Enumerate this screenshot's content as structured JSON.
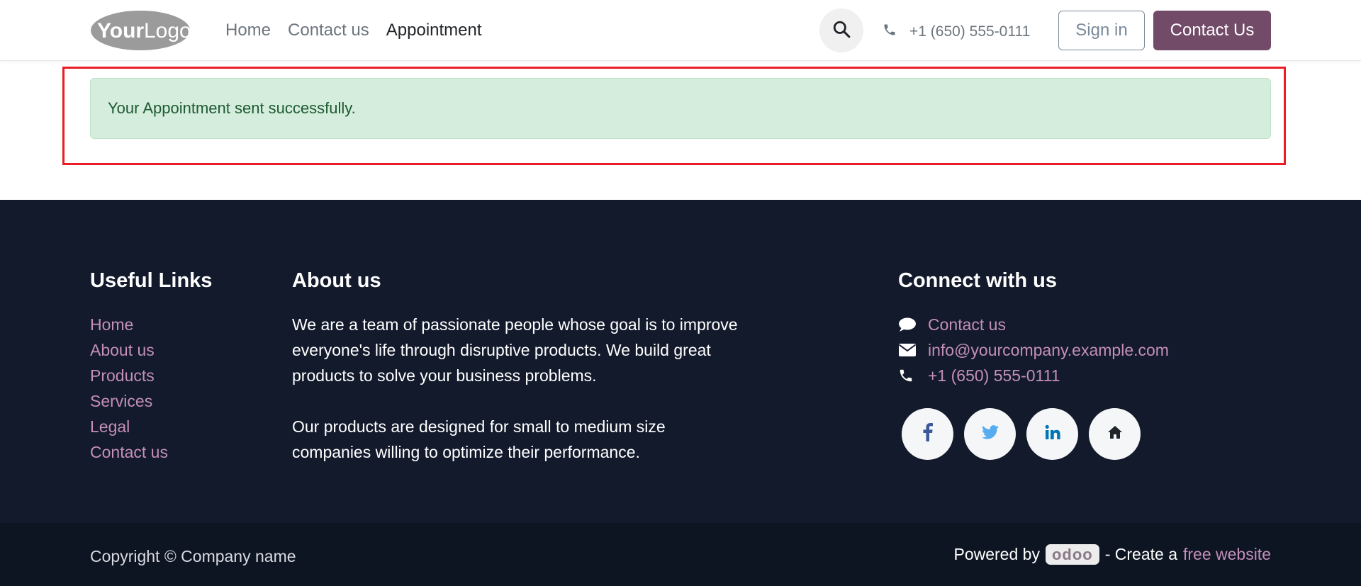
{
  "header": {
    "logo_text": "YourLogo",
    "nav": [
      "Home",
      "Contact us",
      "Appointment"
    ],
    "active_nav": "Appointment",
    "phone": "+1 (650) 555-0111",
    "signin_label": "Sign in",
    "contact_label": "Contact Us"
  },
  "alert": {
    "message": "Your Appointment sent successfully."
  },
  "footer": {
    "useful_links": {
      "title": "Useful Links",
      "items": [
        "Home",
        "About us",
        "Products",
        "Services",
        "Legal",
        "Contact us"
      ]
    },
    "about": {
      "title": "About us",
      "paragraph1": "We are a team of passionate people whose goal is to improve\neveryone's life through disruptive products. We build great\nproducts to solve your business problems.",
      "paragraph2": "Our products are designed for small to medium size\ncompanies willing to optimize their performance."
    },
    "connect": {
      "title": "Connect with us",
      "contact": "Contact us",
      "email": "info@yourcompany.example.com",
      "phone": "+1 (650) 555-0111",
      "social_icons": [
        "facebook-icon",
        "twitter-icon",
        "linkedin-icon",
        "home-icon"
      ]
    }
  },
  "bottom": {
    "copyright": "Copyright © Company name",
    "powered_by": "Powered by",
    "odoo": "odoo",
    "create": "- Create a",
    "free_website": "free website"
  },
  "colors": {
    "brand": "#714b67",
    "link": "#c48fb8",
    "footer_bg": "#121a2c",
    "alert_bg": "#d4eddc",
    "alert_text": "#1e5a33",
    "highlight": "#ec1c24"
  }
}
